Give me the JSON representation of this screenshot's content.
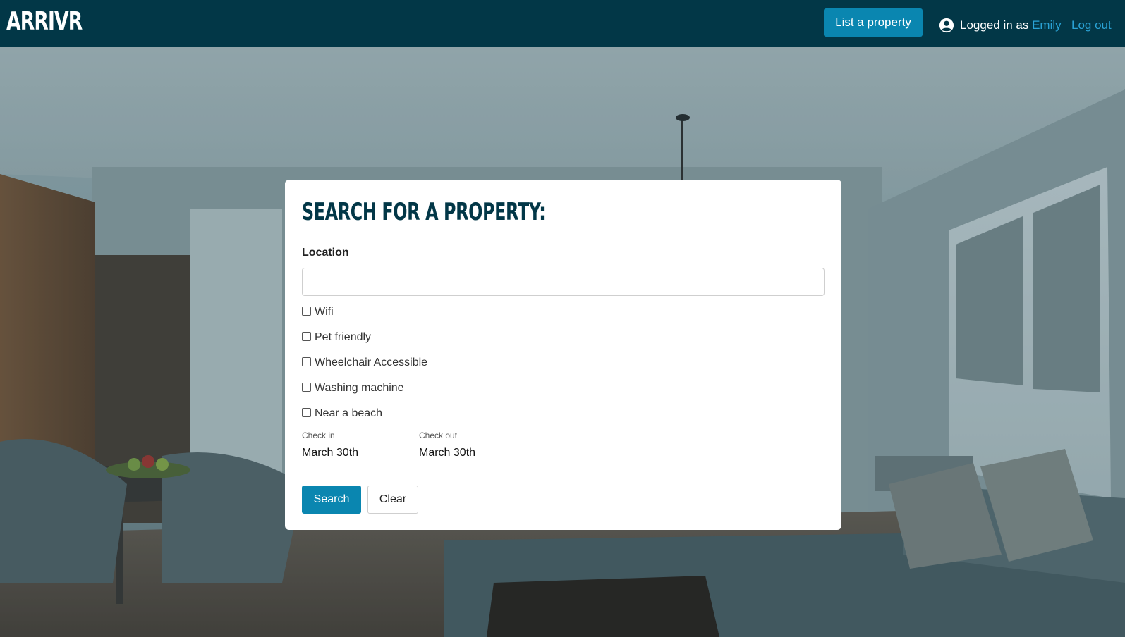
{
  "navbar": {
    "brand": "ARRIVR",
    "list_property_label": "List a property",
    "user_icon": "user-circle-icon",
    "logged_in_prefix": "Logged in as ",
    "username": "Emily",
    "logout_label": "Log out",
    "colors": {
      "background": "#023747",
      "accent": "#0a86b0",
      "link": "#2aa3d6"
    }
  },
  "search": {
    "title": "Search for a property:",
    "location_label": "Location",
    "location_value": "",
    "location_placeholder": "",
    "amenities": [
      {
        "label": "Wifi",
        "checked": false
      },
      {
        "label": "Pet friendly",
        "checked": false
      },
      {
        "label": "Wheelchair Accessible",
        "checked": false
      },
      {
        "label": "Washing machine",
        "checked": false
      },
      {
        "label": "Near a beach",
        "checked": false
      }
    ],
    "check_in_label": "Check in",
    "check_in_value": "March 30th",
    "check_out_label": "Check out",
    "check_out_value": "March 30th",
    "search_button": "Search",
    "clear_button": "Clear"
  }
}
